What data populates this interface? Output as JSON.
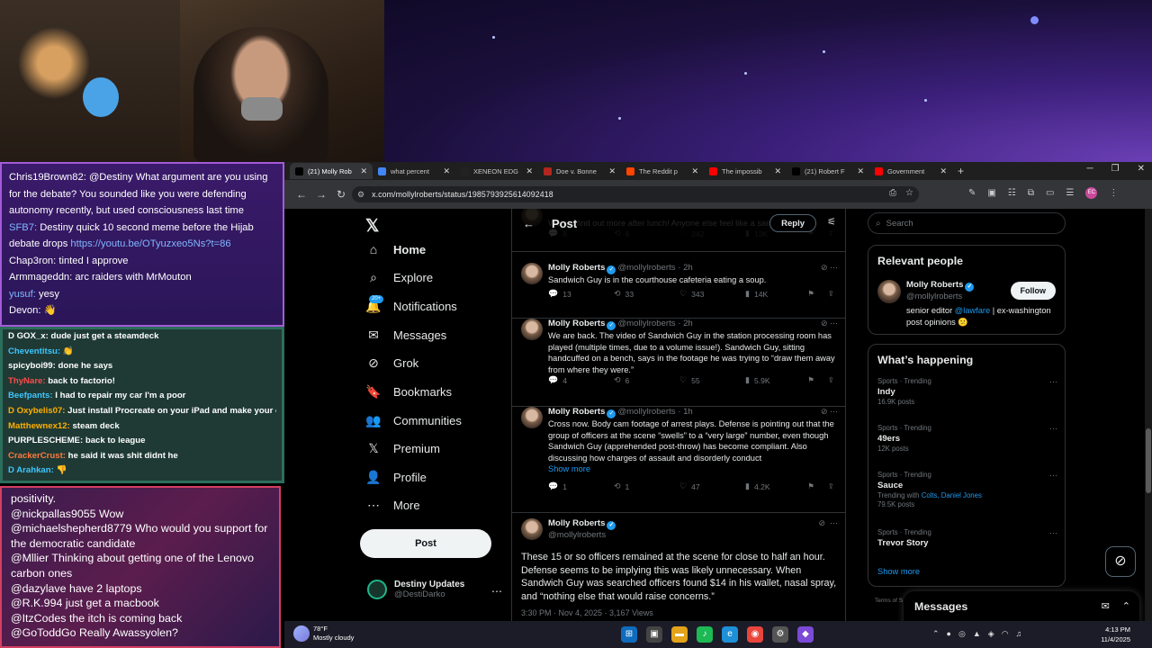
{
  "chat_top": [
    {
      "user": "Chris19Brown82:",
      "text": "@Destiny What argument are you using for the debate? You sounded like you were defending autonomy recently, but used consciousness last time",
      "blue": false
    },
    {
      "user": "SFB7:",
      "text": "Destiny quick 10 second meme before the Hijab debate drops",
      "link": "https://youtu.be/OTyuzxeo5Ns?t=86",
      "blue": true
    },
    {
      "user": "Chap3ron:",
      "text": "tinted I approve",
      "blue": false
    },
    {
      "user": "Armmageddn:",
      "text": "arc raiders with MrMouton",
      "blue": false
    },
    {
      "user": "yusuf:",
      "text": "yesy",
      "blue": true
    },
    {
      "user": "Devon:",
      "text": "👋",
      "blue": false
    }
  ],
  "chat_mid": [
    {
      "user": "D GOX_x:",
      "text": "dude just get a steamdeck",
      "color": "#ffffff"
    },
    {
      "user": "Cheventitsu:",
      "text": "👏",
      "color": "#3cc7ff"
    },
    {
      "user": "spicyboi99:",
      "text": "done he says",
      "color": "#ffffff"
    },
    {
      "user": "ThyNare:",
      "text": "back to factorio!",
      "color": "#ff4a4a"
    },
    {
      "user": "Beefpants:",
      "text": "I had to repair my car I'm a poor",
      "color": "#3cc7ff"
    },
    {
      "user": "D Oxybelis07:",
      "text": "Just install Procreate on your iPad and make your own comics",
      "color": "#ffb000"
    },
    {
      "user": "Matthewnex12:",
      "text": "steam deck",
      "color": "#ffb000"
    },
    {
      "user": "PURPLESCHEME:",
      "text": "back to league",
      "color": "#ffffff"
    },
    {
      "user": "CrackerCrust:",
      "text": "he said it was shit didnt he",
      "color": "#ff7a3c"
    },
    {
      "user": "D Arahkan:",
      "text": "👎",
      "color": "#3cc7ff"
    }
  ],
  "chat_bot": [
    {
      "user": "",
      "text": "positivity."
    },
    {
      "user": "@nickpallas9055",
      "text": "Wow"
    },
    {
      "user": "@michaelshepherd8779",
      "text": "Who would you support for the democratic candidate"
    },
    {
      "user": "@Mllier",
      "text": "Thinking about getting one of the Lenovo carbon ones"
    },
    {
      "user": "@dazylave",
      "text": "have 2 laptops"
    },
    {
      "user": "@R.K.994",
      "text": "just get a macbook"
    },
    {
      "user": "@ItzCodes",
      "text": "the itch is coming back"
    },
    {
      "user": "@GoToddGo",
      "text": "Really Awassyolen?"
    }
  ],
  "browser": {
    "tabs": [
      {
        "label": "(21) Molly Rob",
        "icon": "x-icon",
        "color": "#000000",
        "active": true
      },
      {
        "label": "what percent",
        "icon": "google-icon",
        "color": "#4285f4",
        "active": false
      },
      {
        "label": "XENEON EDG",
        "icon": "corsair-icon",
        "color": "#222222",
        "active": false
      },
      {
        "label": "Doe v. Bonne",
        "icon": "court-icon",
        "color": "#b3261e",
        "active": false
      },
      {
        "label": "The Reddit p",
        "icon": "reddit-icon",
        "color": "#ff4500",
        "active": false
      },
      {
        "label": "The impossib",
        "icon": "youtube-icon",
        "color": "#ff0000",
        "active": false
      },
      {
        "label": "(21) Robert F",
        "icon": "x-icon",
        "color": "#000000",
        "active": false
      },
      {
        "label": "Government",
        "icon": "youtube-icon",
        "color": "#ff0000",
        "active": false
      }
    ],
    "url": "x.com/mollylroberts/status/1985793925614092418"
  },
  "nav": {
    "items": [
      {
        "label": "Home",
        "icon": "⌂",
        "name": "home"
      },
      {
        "label": "Explore",
        "icon": "⌕",
        "name": "explore"
      },
      {
        "label": "Notifications",
        "icon": "🔔",
        "name": "notifications"
      },
      {
        "label": "Messages",
        "icon": "✉",
        "name": "messages"
      },
      {
        "label": "Grok",
        "icon": "⊘",
        "name": "grok"
      },
      {
        "label": "Bookmarks",
        "icon": "🔖",
        "name": "bookmarks"
      },
      {
        "label": "Communities",
        "icon": "👥",
        "name": "communities"
      },
      {
        "label": "Premium",
        "icon": "𝕏",
        "name": "premium"
      },
      {
        "label": "Profile",
        "icon": "👤",
        "name": "profile"
      },
      {
        "label": "More",
        "icon": "⋯",
        "name": "more"
      }
    ],
    "notif_badge": "20+",
    "post_label": "Post",
    "account_name": "Destiny Updates",
    "account_handle": "@DestiDarko"
  },
  "feed": {
    "title": "Post",
    "reply_label": "Reply",
    "tweets": [
      {
        "name": "",
        "handle": "",
        "time": "",
        "text": "We will find out more after lunch! Anyone else feel like a sandwich?",
        "show_more": false,
        "replies": "8",
        "reposts": "8",
        "likes": "242",
        "views": "13K"
      },
      {
        "name": "Molly Roberts",
        "handle": "@mollylroberts · 2h",
        "time": "",
        "text": "Sandwich Guy is in the courthouse cafeteria eating a soup.",
        "show_more": false,
        "replies": "13",
        "reposts": "33",
        "likes": "343",
        "views": "14K"
      },
      {
        "name": "Molly Roberts",
        "handle": "@mollylroberts · 2h",
        "time": "",
        "text": "We are back. The video of Sandwich Guy in the station processing room has played (multiple times, due to a volume issue!). Sandwich Guy, sitting handcuffed on a bench, says in the footage he was trying to “draw them away from where they were.”",
        "show_more": false,
        "replies": "4",
        "reposts": "6",
        "likes": "55",
        "views": "5.9K"
      },
      {
        "name": "Molly Roberts",
        "handle": "@mollylroberts · 1h",
        "time": "",
        "text": "Cross now. Body cam footage of arrest plays. Defense is pointing out that the group of officers at the scene “swells” to a “very large” number, even though Sandwich Guy (apprehended post-throw) has become compliant. Also discussing how charges of assault and disorderly conduct",
        "show_more": true,
        "show_more_label": "Show more",
        "replies": "1",
        "reposts": "1",
        "likes": "47",
        "views": "4.2K"
      }
    ],
    "main": {
      "name": "Molly Roberts",
      "handle": "@mollylroberts",
      "text": "These 15 or so officers remained at the scene for close to half an hour. Defense seems to be implying this was likely unnecessary. When Sandwich Guy was searched officers found $14 in his wallet, nasal spray, and “nothing else that would raise concerns.”",
      "meta": "3:30 PM · Nov 4, 2025 · 3,167 Views"
    }
  },
  "right": {
    "search_placeholder": "Search",
    "relevant_title": "Relevant people",
    "person_name": "Molly Roberts",
    "person_handle": "@mollylroberts",
    "person_bio_1": "senior editor ",
    "person_bio_mention": "@lawfare",
    "person_bio_2": " | ex-washington post opinions 😕",
    "follow_label": "Follow",
    "happening_title": "What’s happening",
    "trends": [
      {
        "category": "Sports · Trending",
        "title": "Indy",
        "sub": "16.9K posts",
        "with": ""
      },
      {
        "category": "Sports · Trending",
        "title": "49ers",
        "sub": "12K posts",
        "with": ""
      },
      {
        "category": "Sports · Trending",
        "title": "Sauce",
        "sub": "79.5K posts",
        "with": "Colts, Daniel Jones"
      },
      {
        "category": "Sports · Trending",
        "title": "Trevor Story",
        "sub": "",
        "with": ""
      }
    ],
    "trending_with_label": "Trending with ",
    "show_more_label": "Show more",
    "terms": "Terms of S",
    "messages_label": "Messages"
  },
  "taskbar": {
    "temp": "78°F",
    "weather": "Mostly cloudy",
    "time": "4:13 PM",
    "date": "11/4/2025"
  }
}
